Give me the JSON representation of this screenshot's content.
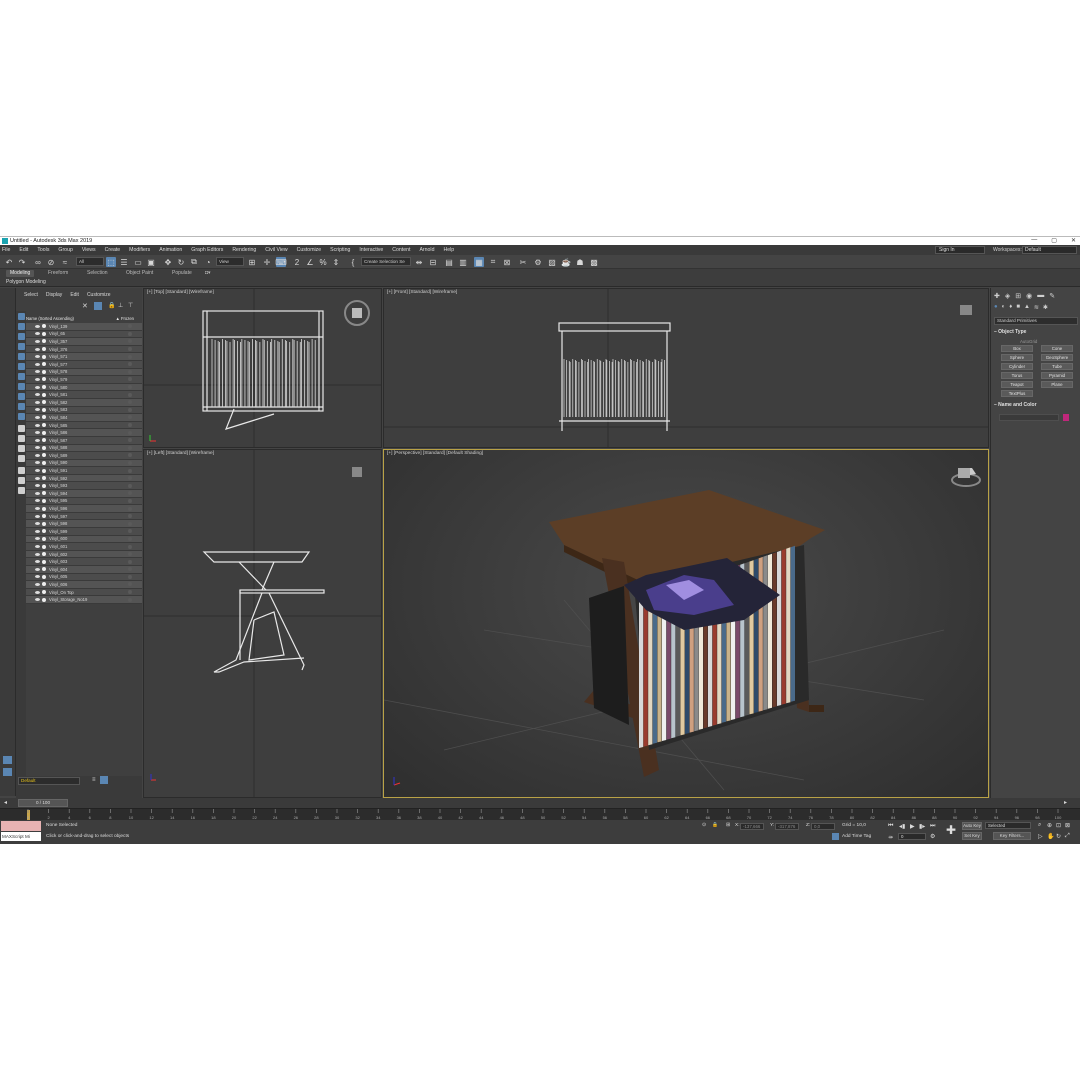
{
  "window": {
    "title": "Untitled - Autodesk 3ds Max 2019",
    "controls": [
      "—",
      "▢",
      "✕"
    ]
  },
  "menu": [
    "File",
    "Edit",
    "Tools",
    "Group",
    "Views",
    "Create",
    "Modifiers",
    "Animation",
    "Graph Editors",
    "Rendering",
    "Civil View",
    "Customize",
    "Scripting",
    "Interactive",
    "Content",
    "Arnold",
    "Help"
  ],
  "account": {
    "sign_in": "Sign In",
    "workspaces_label": "Workspaces:",
    "workspace": "Default"
  },
  "toolbar": {
    "filter": "All",
    "ref_coord": "View",
    "selection_set": "Create Selection Se"
  },
  "ribbon": {
    "tabs": [
      "Modeling",
      "Freeform",
      "Selection",
      "Object Paint",
      "Populate"
    ],
    "active_tab": "Modeling",
    "panel": "Polygon Modeling"
  },
  "scene_explorer": {
    "menu": [
      "Select",
      "Display",
      "Edit",
      "Customize"
    ],
    "col_name": "Name (Sorted Ascending)",
    "col_frozen": "▲ Frozen",
    "objects": [
      "Vinyl_139",
      "Vinyl_65",
      "Vinyl_357",
      "Vinyl_376",
      "Vinyl_571",
      "Vinyl_577",
      "Vinyl_578",
      "Vinyl_579",
      "Vinyl_580",
      "Vinyl_581",
      "Vinyl_582",
      "Vinyl_583",
      "Vinyl_584",
      "Vinyl_585",
      "Vinyl_586",
      "Vinyl_587",
      "Vinyl_588",
      "Vinyl_589",
      "Vinyl_590",
      "Vinyl_591",
      "Vinyl_592",
      "Vinyl_593",
      "Vinyl_594",
      "Vinyl_595",
      "Vinyl_596",
      "Vinyl_597",
      "Vinyl_598",
      "Vinyl_599",
      "Vinyl_600",
      "Vinyl_601",
      "Vinyl_602",
      "Vinyl_603",
      "Vinyl_604",
      "Vinyl_605",
      "Vinyl_606",
      "Vinyl_On Top",
      "Vinyl_Storage_No19"
    ],
    "layer": "Default"
  },
  "viewports": {
    "top": "[+] [Top] [Standard] [Wireframe]",
    "front": "[+] [Front] [Standard] [Wireframe]",
    "left": "[+] [Left] [Standard] [Wireframe]",
    "perspective": "[+] [Perspective] [Standard] [Default Shading]"
  },
  "command_panel": {
    "category": "Standard Primitives",
    "object_type_title": "Object Type",
    "autogrid": "AutoGrid",
    "primitives": [
      "Box",
      "Cone",
      "Sphere",
      "GeoSphere",
      "Cylinder",
      "Tube",
      "Torus",
      "Pyramid",
      "Teapot",
      "Plane",
      "TextPlus"
    ],
    "name_color_title": "Name and Color",
    "swatch_color": "#c0277b"
  },
  "timeline": {
    "frame_indicator": "0 / 100",
    "ticks": [
      "0",
      "2",
      "4",
      "6",
      "8",
      "10",
      "12",
      "14",
      "16",
      "18",
      "20",
      "22",
      "24",
      "26",
      "28",
      "30",
      "32",
      "34",
      "36",
      "38",
      "40",
      "42",
      "44",
      "46",
      "48",
      "50",
      "52",
      "54",
      "56",
      "58",
      "60",
      "62",
      "64",
      "66",
      "68",
      "70",
      "72",
      "74",
      "76",
      "78",
      "80",
      "82",
      "84",
      "86",
      "88",
      "90",
      "92",
      "94",
      "96",
      "98",
      "100"
    ]
  },
  "status": {
    "maxscript": "MAXScript Mi",
    "selection": "None Selected",
    "prompt": "Click or click-and-drag to select objects",
    "x_label": "X:",
    "x_value": "-137,666",
    "y_label": "Y:",
    "y_value": "-317,876",
    "z_label": "Z:",
    "z_value": "0,0",
    "grid": "Grid = 10,0",
    "add_time_tag": "Add Time Tag",
    "auto_key": "Auto Key",
    "set_key": "Set Key",
    "key_set": "Selected",
    "key_filters": "Key Filters...",
    "frame_field": "0"
  }
}
